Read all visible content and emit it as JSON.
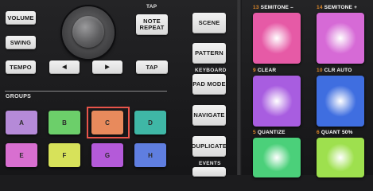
{
  "left_buttons": {
    "volume": "VOLUME",
    "swing": "SWING",
    "tempo": "TEMPO"
  },
  "transport": {
    "tap_caption": "TAP",
    "note_repeat": "NOTE REPEAT",
    "left_arrow": "◀",
    "right_arrow": "▶",
    "tap": "TAP"
  },
  "groups": {
    "title": "GROUPS",
    "pads": [
      {
        "label": "A",
        "color": "#b58ad8"
      },
      {
        "label": "B",
        "color": "#6ccf6a"
      },
      {
        "label": "C",
        "color": "#e88a5c"
      },
      {
        "label": "D",
        "color": "#3fb7a6"
      },
      {
        "label": "E",
        "color": "#d86fd0"
      },
      {
        "label": "F",
        "color": "#d7e25a"
      },
      {
        "label": "G",
        "color": "#b45ad9"
      },
      {
        "label": "H",
        "color": "#5f7ee0"
      }
    ],
    "selected": "C"
  },
  "mode_buttons": {
    "scene": "SCENE",
    "pattern": "PATTERN",
    "keyboard_caption": "KEYBOARD",
    "pad_mode": "PAD MODE",
    "navigate": "NAVIGATE",
    "duplicate": "DUPLICATE",
    "events_caption": "EVENTS"
  },
  "pads": [
    {
      "num": "13",
      "label": "SEMITONE –",
      "color": "#e65aa6"
    },
    {
      "num": "14",
      "label": "SEMITONE +",
      "color": "#d66ad6"
    },
    {
      "num": "9",
      "label": "CLEAR",
      "color": "#a85de0"
    },
    {
      "num": "10",
      "label": "CLR AUTO",
      "color": "#3f6ee0"
    },
    {
      "num": "5",
      "label": "QUANTIZE",
      "color": "#4bd07a"
    },
    {
      "num": "6",
      "label": "QUANT 50%",
      "color": "#9ee04e"
    }
  ]
}
